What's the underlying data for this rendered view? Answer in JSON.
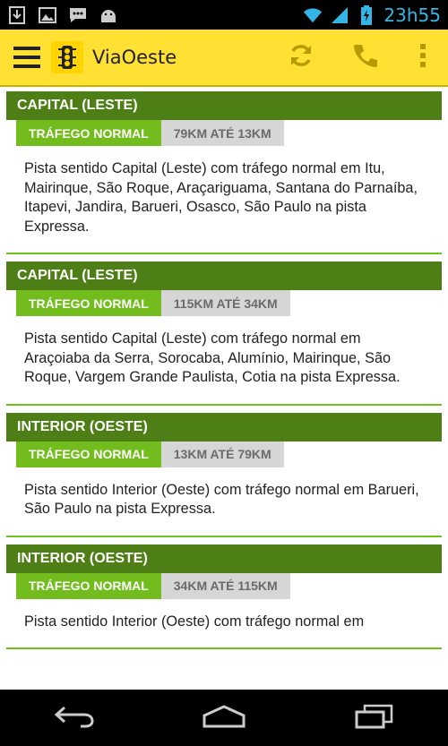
{
  "status_bar": {
    "time": "23h55",
    "icons": [
      "download-icon",
      "image-icon",
      "chat-icon",
      "android-icon",
      "wifi-icon",
      "signal-icon",
      "battery-icon"
    ]
  },
  "action_bar": {
    "title": "ViaOeste",
    "icons": [
      "menu-icon",
      "traffic-light-icon",
      "refresh-icon",
      "phone-icon",
      "overflow-icon"
    ],
    "accent_color": "#ffe033"
  },
  "cards": [
    {
      "direction": "CAPITAL (LESTE)",
      "status": "TRÁFEGO NORMAL",
      "range": "79KM ATÉ 13KM",
      "description": "Pista sentido Capital (Leste) com tráfego normal em Itu, Mairinque, São Roque, Araçariguama, Santana do Parnaíba, Itapevi, Jandira, Barueri, Osasco, São Paulo na pista Expressa."
    },
    {
      "direction": "CAPITAL (LESTE)",
      "status": "TRÁFEGO NORMAL",
      "range": "115KM ATÉ 34KM",
      "description": "Pista sentido Capital (Leste) com tráfego normal em Araçoiaba da Serra, Sorocaba, Alumínio, Mairinque, São Roque, Vargem Grande Paulista, Cotia  na pista Expressa."
    },
    {
      "direction": "INTERIOR (OESTE)",
      "status": "TRÁFEGO NORMAL",
      "range": "13KM ATÉ 79KM",
      "description": "Pista sentido Interior (Oeste) com tráfego normal em Barueri, São Paulo  na pista Expressa."
    },
    {
      "direction": "INTERIOR (OESTE)",
      "status": "TRÁFEGO NORMAL",
      "range": "34KM ATÉ 115KM",
      "description": "Pista sentido Interior (Oeste) com tráfego normal em"
    }
  ],
  "colors": {
    "title_bg": "#4d7f16",
    "status_bg": "#72bd1d",
    "range_bg": "#d6d6d6",
    "divider": "#6fc21a"
  },
  "nav_bar": {
    "icons": [
      "back-icon",
      "home-icon",
      "recent-apps-icon"
    ]
  }
}
